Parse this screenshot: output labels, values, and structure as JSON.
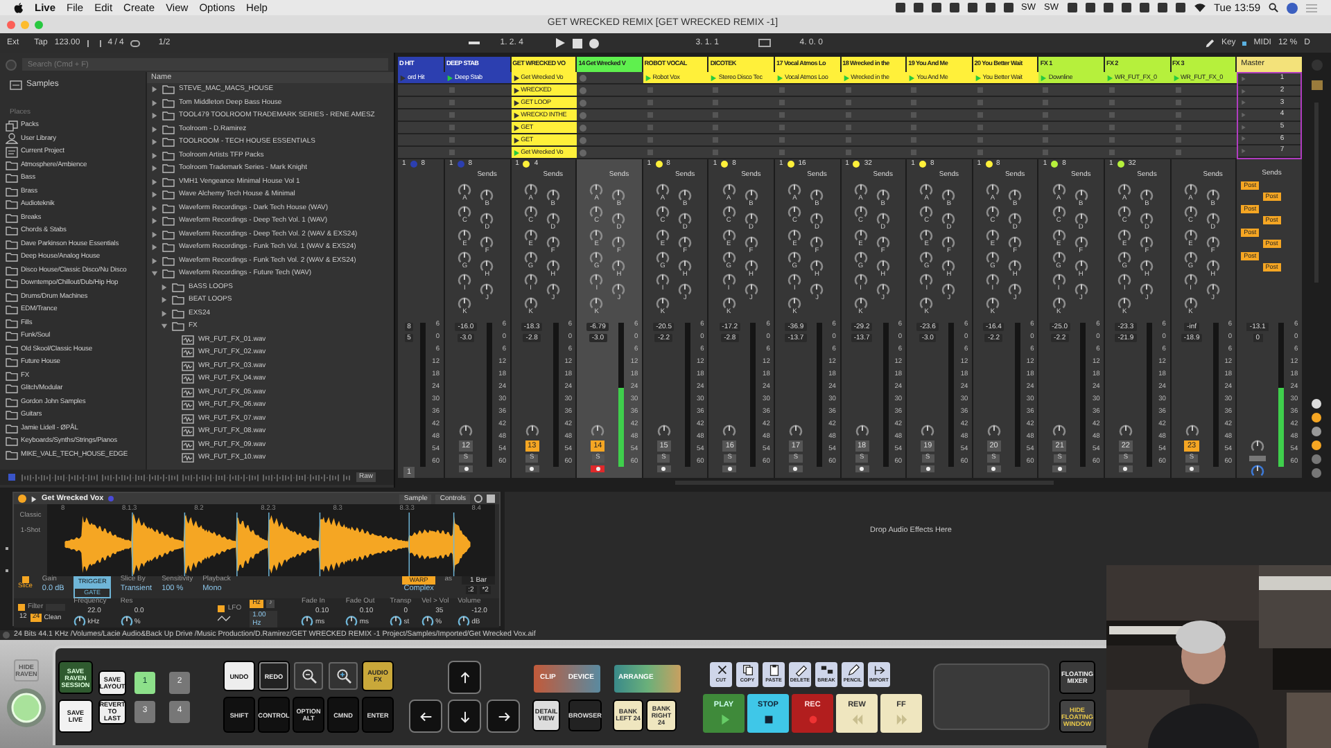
{
  "menubar": {
    "app": "Live",
    "menus": [
      "File",
      "Edit",
      "Create",
      "View",
      "Options",
      "Help"
    ],
    "extras": [
      "SW",
      "SW"
    ],
    "clock": "Tue 13:59"
  },
  "window": {
    "title": "GET WRECKED REMIX  [GET WRECKED REMIX -1]"
  },
  "transport": {
    "sync": "Ext",
    "tap": "Tap",
    "tempo": "123.00",
    "signature": "4 / 4",
    "quantize": "1/2",
    "position": "1.  2.  4",
    "loop_start": "3.  1.  1",
    "loop_length": "4.  0.  0",
    "key": "Key",
    "midi": "MIDI",
    "cpu": "12 %",
    "disk": "D"
  },
  "browser": {
    "search": {
      "placeholder": "Search (Cmd + F)"
    },
    "samples": "Samples",
    "places_label": "Places",
    "places": [
      {
        "label": "Packs",
        "kind": "pack"
      },
      {
        "label": "User Library",
        "kind": "user"
      },
      {
        "label": "Current Project",
        "kind": "project"
      },
      {
        "label": "Atmosphere/Ambience",
        "kind": "folder"
      },
      {
        "label": "Bass",
        "kind": "folder"
      },
      {
        "label": "Brass",
        "kind": "folder"
      },
      {
        "label": "Audioteknik",
        "kind": "folder"
      },
      {
        "label": "Breaks",
        "kind": "folder"
      },
      {
        "label": "Chords & Stabs",
        "kind": "folder"
      },
      {
        "label": "Dave Parkinson House Essentials",
        "kind": "folder"
      },
      {
        "label": "Deep House/Analog House",
        "kind": "folder"
      },
      {
        "label": "Disco House/Classic Disco/Nu Disco",
        "kind": "folder"
      },
      {
        "label": "Downtempo/Chillout/Dub/Hip Hop",
        "kind": "folder"
      },
      {
        "label": "Drums/Drum Machines",
        "kind": "folder"
      },
      {
        "label": "EDM/Trance",
        "kind": "folder"
      },
      {
        "label": "Fills",
        "kind": "folder"
      },
      {
        "label": "Funk/Soul",
        "kind": "folder"
      },
      {
        "label": "Old Skool/Classic House",
        "kind": "folder"
      },
      {
        "label": "Future House",
        "kind": "folder"
      },
      {
        "label": "FX",
        "kind": "folder"
      },
      {
        "label": "Glitch/Modular",
        "kind": "folder"
      },
      {
        "label": "Gordon John Samples",
        "kind": "folder"
      },
      {
        "label": "Guitars",
        "kind": "folder"
      },
      {
        "label": "Jamie Lidell - ØPÅL",
        "kind": "folder"
      },
      {
        "label": "Keyboards/Synths/Strings/Pianos",
        "kind": "folder"
      },
      {
        "label": "MIKE_VALE_TECH_HOUSE_EDGE",
        "kind": "folder"
      }
    ],
    "column": "Name",
    "items": [
      {
        "label": "STEVE_MAC_MACS_HOUSE",
        "kind": "folder",
        "expanded": false
      },
      {
        "label": "Tom Middleton Deep Bass House",
        "kind": "folder",
        "expanded": false
      },
      {
        "label": "TOOL479 TOOLROOM TRADEMARK SERIES - RENE AMESZ",
        "kind": "folder",
        "expanded": false
      },
      {
        "label": "Toolroom - D.Ramirez",
        "kind": "folder",
        "expanded": false
      },
      {
        "label": "TOOLROOM - TECH HOUSE ESSENTIALS",
        "kind": "folder",
        "expanded": false
      },
      {
        "label": "Toolroom Artists TFP Packs",
        "kind": "folder",
        "expanded": false
      },
      {
        "label": "Toolroom Trademark Series - Mark Knight",
        "kind": "folder",
        "expanded": false
      },
      {
        "label": "VMH1 Vengeance Minimal House Vol 1",
        "kind": "folder",
        "expanded": false
      },
      {
        "label": "Wave Alchemy Tech House & Minimal",
        "kind": "folder",
        "expanded": false
      },
      {
        "label": "Waveform Recordings - Dark Tech House (WAV)",
        "kind": "folder",
        "expanded": false
      },
      {
        "label": "Waveform Recordings - Deep Tech Vol. 1 (WAV)",
        "kind": "folder",
        "expanded": false
      },
      {
        "label": "Waveform Recordings - Deep Tech Vol. 2 (WAV & EXS24)",
        "kind": "folder",
        "expanded": false
      },
      {
        "label": "Waveform Recordings - Funk Tech Vol. 1 (WAV & EXS24)",
        "kind": "folder",
        "expanded": false
      },
      {
        "label": "Waveform Recordings - Funk Tech Vol. 2 (WAV & EXS24)",
        "kind": "folder",
        "expanded": false
      },
      {
        "label": "Waveform Recordings - Future Tech (WAV)",
        "kind": "folder",
        "expanded": true,
        "children": [
          {
            "label": "BASS LOOPS",
            "kind": "folder",
            "expanded": false
          },
          {
            "label": "BEAT LOOPS",
            "kind": "folder",
            "expanded": false
          },
          {
            "label": "EXS24",
            "kind": "folder",
            "expanded": false
          },
          {
            "label": "FX",
            "kind": "folder",
            "expanded": true,
            "children": [
              {
                "label": "WR_FUT_FX_01.wav",
                "kind": "file"
              },
              {
                "label": "WR_FUT_FX_02.wav",
                "kind": "file"
              },
              {
                "label": "WR_FUT_FX_03.wav",
                "kind": "file"
              },
              {
                "label": "WR_FUT_FX_04.wav",
                "kind": "file"
              },
              {
                "label": "WR_FUT_FX_05.wav",
                "kind": "file"
              },
              {
                "label": "WR_FUT_FX_06.wav",
                "kind": "file"
              },
              {
                "label": "WR_FUT_FX_07.wav",
                "kind": "file"
              },
              {
                "label": "WR_FUT_FX_08.wav",
                "kind": "file"
              },
              {
                "label": "WR_FUT_FX_09.wav",
                "kind": "file"
              },
              {
                "label": "WR_FUT_FX_10.wav",
                "kind": "file"
              }
            ]
          }
        ]
      }
    ],
    "preview": "Raw"
  },
  "tracks": [
    {
      "name": "D HIT",
      "color": "#2c3fb0",
      "clips": [
        {
          "kind": "clip",
          "name": "ord Hit",
          "playing": false
        },
        {
          "kind": "blank"
        },
        {
          "kind": "blank"
        },
        {
          "kind": "blank"
        },
        {
          "kind": "blank"
        },
        {
          "kind": "blank"
        },
        {
          "kind": "blank"
        }
      ],
      "mixer": {
        "quant": [
          "1",
          "8"
        ],
        "volume": "8",
        "pan": "5",
        "scale": [
          "6",
          "0",
          "6",
          "12",
          "18",
          "24",
          "30",
          "36",
          "42",
          "48",
          "54",
          "60"
        ],
        "number": "1",
        "active": false,
        "selected": false
      }
    },
    {
      "name": "DEEP STAB",
      "color": "#2c3fb0",
      "clips": [
        {
          "kind": "clip",
          "name": "Deep Stab",
          "playing": true
        },
        {
          "kind": "stop"
        },
        {
          "kind": "stop"
        },
        {
          "kind": "stop"
        },
        {
          "kind": "stop"
        },
        {
          "kind": "stop"
        },
        {
          "kind": "stop"
        }
      ],
      "mixer": {
        "quant": [
          "1",
          "8"
        ],
        "sends_label": "Sends",
        "sends": [
          "A",
          "B",
          "C",
          "D",
          "E",
          "F",
          "G",
          "H",
          "I",
          "J",
          "K"
        ],
        "volume": "-16.0",
        "pan": "-3.0",
        "scale": [
          "6",
          "0",
          "6",
          "12",
          "18",
          "24",
          "30",
          "36",
          "42",
          "48",
          "54",
          "60"
        ],
        "number": "12",
        "solo": "S",
        "active": false,
        "selected": false,
        "armed": false
      }
    },
    {
      "name": "GET WRECKED VO",
      "color": "#fff03a",
      "clips": [
        {
          "kind": "clip",
          "name": "Get Wrecked Vo",
          "playing": false
        },
        {
          "kind": "clip",
          "name": "WRECKED",
          "playing": false
        },
        {
          "kind": "clip",
          "name": "GET LOOP",
          "playing": false
        },
        {
          "kind": "clip",
          "name": "WRECKD INTHE",
          "playing": false
        },
        {
          "kind": "clip",
          "name": "GET",
          "playing": false
        },
        {
          "kind": "clip",
          "name": "GET",
          "playing": false
        },
        {
          "kind": "clip",
          "name": "Get Wrecked Vo",
          "playing": true
        }
      ],
      "mixer": {
        "quant": [
          "1",
          "4"
        ],
        "sends_label": "Sends",
        "sends": [
          "A",
          "B",
          "C",
          "D",
          "E",
          "F",
          "G",
          "H",
          "I",
          "J",
          "K"
        ],
        "volume": "-18.3",
        "pan": "-2.8",
        "scale": [
          "6",
          "0",
          "6",
          "12",
          "18",
          "24",
          "30",
          "36",
          "42",
          "48",
          "54",
          "60"
        ],
        "number": "13",
        "solo": "S",
        "active": true,
        "selected": false,
        "armed": false
      }
    },
    {
      "name": "14 Get Wrecked V",
      "color": "#5ff04e",
      "clips": [
        {
          "kind": "rec"
        },
        {
          "kind": "rec"
        },
        {
          "kind": "rec"
        },
        {
          "kind": "rec"
        },
        {
          "kind": "rec"
        },
        {
          "kind": "rec"
        },
        {
          "kind": "rec"
        }
      ],
      "mixer": {
        "sends_label": "Sends",
        "sends": [
          "A",
          "B",
          "C",
          "D",
          "E",
          "F",
          "G",
          "H",
          "I",
          "J",
          "K"
        ],
        "volume": "-6.79",
        "pan": "-3.0",
        "scale": [
          "6",
          "0",
          "6",
          "12",
          "18",
          "24",
          "30",
          "36",
          "42",
          "48",
          "54",
          "60"
        ],
        "number": "14",
        "solo": "S",
        "active": true,
        "selected": true,
        "armed": true,
        "level": 0.55
      }
    },
    {
      "name": "ROBOT VOCAL",
      "color": "#fff03a",
      "clips": [
        {
          "kind": "clip",
          "name": "Robot Vox",
          "playing": true
        },
        {
          "kind": "stop"
        },
        {
          "kind": "stop"
        },
        {
          "kind": "stop"
        },
        {
          "kind": "stop"
        },
        {
          "kind": "stop"
        },
        {
          "kind": "stop"
        }
      ],
      "mixer": {
        "quant": [
          "1",
          "8"
        ],
        "sends_label": "Sends",
        "sends": [
          "A",
          "B",
          "C",
          "D",
          "E",
          "F",
          "G",
          "H",
          "I",
          "J",
          "K"
        ],
        "volume": "-20.5",
        "pan": "-2.2",
        "scale": [
          "6",
          "0",
          "6",
          "12",
          "18",
          "24",
          "30",
          "36",
          "42",
          "48",
          "54",
          "60"
        ],
        "number": "15",
        "solo": "S",
        "active": false,
        "selected": false,
        "armed": false
      }
    },
    {
      "name": "DICOTEK",
      "color": "#fff03a",
      "clips": [
        {
          "kind": "clip",
          "name": "Stereo Disco Tec",
          "playing": true
        },
        {
          "kind": "stop"
        },
        {
          "kind": "stop"
        },
        {
          "kind": "stop"
        },
        {
          "kind": "stop"
        },
        {
          "kind": "stop"
        },
        {
          "kind": "stop"
        }
      ],
      "mixer": {
        "quant": [
          "1",
          "8"
        ],
        "sends_label": "Sends",
        "sends": [
          "A",
          "B",
          "C",
          "D",
          "E",
          "F",
          "G",
          "H",
          "I",
          "J",
          "K"
        ],
        "volume": "-17.2",
        "pan": "-2.8",
        "scale": [
          "6",
          "0",
          "6",
          "12",
          "18",
          "24",
          "30",
          "36",
          "42",
          "48",
          "54",
          "60"
        ],
        "number": "16",
        "solo": "S",
        "active": false,
        "selected": false,
        "armed": false
      }
    },
    {
      "name": "17 Vocal Atmos Lo",
      "color": "#fff03a",
      "clips": [
        {
          "kind": "clip",
          "name": "Vocal Atmos Loo",
          "playing": true
        },
        {
          "kind": "stop"
        },
        {
          "kind": "stop"
        },
        {
          "kind": "stop"
        },
        {
          "kind": "stop"
        },
        {
          "kind": "stop"
        },
        {
          "kind": "stop"
        }
      ],
      "mixer": {
        "quant": [
          "1",
          "16"
        ],
        "sends_label": "Sends",
        "sends": [
          "A",
          "B",
          "C",
          "D",
          "E",
          "F",
          "G",
          "H",
          "I",
          "J",
          "K"
        ],
        "volume": "-36.9",
        "pan": "-13.7",
        "scale": [
          "6",
          "0",
          "6",
          "12",
          "18",
          "24",
          "30",
          "36",
          "42",
          "48",
          "54",
          "60"
        ],
        "number": "17",
        "solo": "S",
        "active": false,
        "selected": false,
        "armed": false
      }
    },
    {
      "name": "18 Wrecked in the",
      "color": "#fff03a",
      "clips": [
        {
          "kind": "clip",
          "name": "Wrecked in the",
          "playing": true
        },
        {
          "kind": "stop"
        },
        {
          "kind": "stop"
        },
        {
          "kind": "stop"
        },
        {
          "kind": "stop"
        },
        {
          "kind": "stop"
        },
        {
          "kind": "stop"
        }
      ],
      "mixer": {
        "quant": [
          "1",
          "32"
        ],
        "sends_label": "Sends",
        "sends": [
          "A",
          "B",
          "C",
          "D",
          "E",
          "F",
          "G",
          "H",
          "I",
          "J",
          "K"
        ],
        "volume": "-29.2",
        "pan": "-13.7",
        "scale": [
          "6",
          "0",
          "6",
          "12",
          "18",
          "24",
          "30",
          "36",
          "42",
          "48",
          "54",
          "60"
        ],
        "number": "18",
        "solo": "S",
        "active": false,
        "selected": false,
        "armed": false
      }
    },
    {
      "name": "19 You And Me",
      "color": "#fff03a",
      "clips": [
        {
          "kind": "clip",
          "name": "You And Me",
          "playing": true
        },
        {
          "kind": "stop"
        },
        {
          "kind": "stop"
        },
        {
          "kind": "stop"
        },
        {
          "kind": "stop"
        },
        {
          "kind": "stop"
        },
        {
          "kind": "stop"
        }
      ],
      "mixer": {
        "quant": [
          "1",
          "8"
        ],
        "sends_label": "Sends",
        "sends": [
          "A",
          "B",
          "C",
          "D",
          "E",
          "F",
          "G",
          "H",
          "I",
          "J",
          "K"
        ],
        "volume": "-23.6",
        "pan": "-3.0",
        "scale": [
          "6",
          "0",
          "6",
          "12",
          "18",
          "24",
          "30",
          "36",
          "42",
          "48",
          "54",
          "60"
        ],
        "number": "19",
        "solo": "S",
        "active": false,
        "selected": false,
        "armed": false
      }
    },
    {
      "name": "20 You Better Wait",
      "color": "#fff03a",
      "clips": [
        {
          "kind": "clip",
          "name": "You Better Wait",
          "playing": true
        },
        {
          "kind": "stop"
        },
        {
          "kind": "stop"
        },
        {
          "kind": "stop"
        },
        {
          "kind": "stop"
        },
        {
          "kind": "stop"
        },
        {
          "kind": "stop"
        }
      ],
      "mixer": {
        "quant": [
          "1",
          "8"
        ],
        "sends_label": "Sends",
        "sends": [
          "A",
          "B",
          "C",
          "D",
          "E",
          "F",
          "G",
          "H",
          "I",
          "J",
          "K"
        ],
        "volume": "-16.4",
        "pan": "-2.2",
        "scale": [
          "6",
          "0",
          "6",
          "12",
          "18",
          "24",
          "30",
          "36",
          "42",
          "48",
          "54",
          "60"
        ],
        "number": "20",
        "solo": "S",
        "active": false,
        "selected": false,
        "armed": false
      }
    },
    {
      "name": "FX 1",
      "color": "#b6f03c",
      "clips": [
        {
          "kind": "clip",
          "name": "Downline",
          "playing": true
        },
        {
          "kind": "stop"
        },
        {
          "kind": "stop"
        },
        {
          "kind": "stop"
        },
        {
          "kind": "stop"
        },
        {
          "kind": "stop"
        },
        {
          "kind": "stop"
        }
      ],
      "mixer": {
        "quant": [
          "1",
          "8"
        ],
        "sends_label": "Sends",
        "sends": [
          "A",
          "B",
          "C",
          "D",
          "E",
          "F",
          "G",
          "H",
          "I",
          "J",
          "K"
        ],
        "volume": "-25.0",
        "pan": "-2.2",
        "scale": [
          "6",
          "0",
          "6",
          "12",
          "18",
          "24",
          "30",
          "36",
          "42",
          "48",
          "54",
          "60"
        ],
        "number": "21",
        "solo": "S",
        "active": false,
        "selected": false,
        "armed": false
      }
    },
    {
      "name": "FX 2",
      "color": "#b6f03c",
      "clips": [
        {
          "kind": "clip",
          "name": "WR_FUT_FX_0",
          "playing": true
        },
        {
          "kind": "stop"
        },
        {
          "kind": "stop"
        },
        {
          "kind": "stop"
        },
        {
          "kind": "stop"
        },
        {
          "kind": "stop"
        },
        {
          "kind": "stop"
        }
      ],
      "mixer": {
        "quant": [
          "1",
          "32"
        ],
        "sends_label": "Sends",
        "sends": [
          "A",
          "B",
          "C",
          "D",
          "E",
          "F",
          "G",
          "H",
          "I",
          "J",
          "K"
        ],
        "volume": "-23.3",
        "pan": "-21.9",
        "scale": [
          "6",
          "0",
          "6",
          "12",
          "18",
          "24",
          "30",
          "36",
          "42",
          "48",
          "54",
          "60"
        ],
        "number": "22",
        "solo": "S",
        "active": false,
        "selected": false,
        "armed": false
      }
    },
    {
      "name": "FX 3",
      "color": "#b6f03c",
      "clips": [
        {
          "kind": "clip",
          "name": "WR_FUT_FX_0",
          "playing": true
        },
        {
          "kind": "stop"
        },
        {
          "kind": "stop"
        },
        {
          "kind": "stop"
        },
        {
          "kind": "stop"
        },
        {
          "kind": "stop"
        },
        {
          "kind": "stop"
        }
      ],
      "mixer": {
        "sends_label": "Sends",
        "sends": [
          "A",
          "B",
          "C",
          "D",
          "E",
          "F",
          "G",
          "H",
          "I",
          "J",
          "K"
        ],
        "volume": "-inf",
        "pan": "-18.9",
        "scale": [
          "6",
          "0",
          "6",
          "12",
          "18",
          "24",
          "30",
          "36",
          "42",
          "48",
          "54",
          "60"
        ],
        "number": "23",
        "solo": "S",
        "active": true,
        "selected": false,
        "armed": false
      }
    }
  ],
  "master": {
    "name": "Master",
    "scenes": [
      "1",
      "2",
      "3",
      "4",
      "5",
      "6",
      "7"
    ],
    "sends_label": "Sends",
    "posts": [
      "Post",
      "Post",
      "Post",
      "Post",
      "Post",
      "Post",
      "Post",
      "Post"
    ],
    "volume": "-13.1",
    "pan": "0",
    "scale": [
      "6",
      "0",
      "6",
      "12",
      "18",
      "24",
      "30",
      "36",
      "42",
      "48",
      "54",
      "60"
    ],
    "level": 0.55
  },
  "device": {
    "title": "Get Wrecked Vox",
    "tabs": [
      "Sample",
      "Controls"
    ],
    "modes": [
      {
        "label": "Classic",
        "selected": false
      },
      {
        "label": "1-Shot",
        "selected": false
      },
      {
        "label": "Slice",
        "selected": true
      }
    ],
    "ruler": [
      "8",
      "8.1.3",
      "8.2",
      "8.2.3",
      "8.3",
      "8.3.3",
      "8.4"
    ],
    "gain": {
      "label": "Gain",
      "value": "0.0 dB"
    },
    "trigger": [
      {
        "label": "TRIGGER",
        "selected": true
      },
      {
        "label": "GATE",
        "selected": false
      }
    ],
    "slice_by": {
      "label": "Slice By",
      "value": "Transient"
    },
    "sensitivity": {
      "label": "Sensitivity",
      "value": "100 %"
    },
    "playback": {
      "label": "Playback",
      "value": "Mono"
    },
    "warp": {
      "label": "WARP",
      "on": true
    },
    "as": "as",
    "bars": "1 Bar",
    "half": ":2",
    "double": "*2",
    "warp_mode": "Complex",
    "filter": {
      "label": "Filter",
      "on": true
    },
    "slopes": [
      {
        "label": "12",
        "selected": false
      },
      {
        "label": "24",
        "selected": true
      }
    ],
    "circuit": "Clean",
    "knobs": [
      {
        "label": "Frequency",
        "value": "22.0 kHz"
      },
      {
        "label": "Res",
        "value": "0.0 %"
      }
    ],
    "lfo": {
      "label": "LFO",
      "on": true
    },
    "lfo_modes": [
      {
        "label": "Hz",
        "selected": true
      },
      {
        "label": "♪",
        "selected": false
      }
    ],
    "lfo_rate": "1.00 Hz",
    "envelope": [
      {
        "label": "Fade In",
        "value": "0.10 ms"
      },
      {
        "label": "Fade Out",
        "value": "0.10 ms"
      },
      {
        "label": "Transp",
        "value": "0 st"
      },
      {
        "label": "Vel > Vol",
        "value": "35 %"
      },
      {
        "label": "Volume",
        "value": "-12.0 dB"
      }
    ]
  },
  "effects_drop": "Drop Audio Effects Here",
  "status_bar": "24 Bits 44.1 KHz /Volumes/Lacie Audio&Back Up Drive /Music Production/D.Ramirez/GET WRECKED REMIX -1 Project/Samples/Imported/Get Wrecked Vox.aif",
  "raven": {
    "hide": "HIDE RAVEN",
    "save_session": "SAVE RAVEN SESSION",
    "save_live": "SAVE LIVE",
    "layouts": [
      {
        "label": "SAVE LAYOUT",
        "kind": "action"
      },
      {
        "label": "1",
        "kind": "slot",
        "selected": true
      },
      {
        "label": "2",
        "kind": "slot",
        "selected": false
      },
      {
        "label": "REVERT TO LAST",
        "kind": "action"
      },
      {
        "label": "3",
        "kind": "slot",
        "selected": false
      },
      {
        "label": "4",
        "kind": "slot",
        "selected": false
      }
    ],
    "edit": [
      {
        "label": "UNDO",
        "kind": "light"
      },
      {
        "label": "REDO",
        "kind": "dark"
      },
      {
        "kind": "zoom-out"
      },
      {
        "kind": "zoom-in"
      },
      {
        "label": "AUDIO FX",
        "kind": "gold"
      }
    ],
    "modifiers": [
      "SHIFT",
      "CONTROL",
      "OPTION ALT",
      "CMND",
      "ENTER"
    ],
    "arrows": [
      {
        "kind": "up"
      },
      {
        "kind": "left"
      },
      {
        "kind": "down"
      },
      {
        "kind": "right"
      }
    ],
    "clip_device": [
      "CLIP",
      "DEVICE"
    ],
    "arrange": "ARRANGE",
    "views": [
      "DETAIL VIEW",
      "BROWSER"
    ],
    "banks": [
      "BANK LEFT 24",
      "BANK RIGHT 24"
    ],
    "tools": [
      "CUT",
      "COPY",
      "PASTE",
      "DELETE",
      "BREAK",
      "PENCIL",
      "IMPORT"
    ],
    "transport": [
      {
        "label": "PLAY",
        "kind": "play"
      },
      {
        "label": "STOP",
        "kind": "stop"
      },
      {
        "label": "REC",
        "kind": "rec"
      },
      {
        "label": "REW",
        "kind": "rew"
      },
      {
        "label": "FF",
        "kind": "ff"
      }
    ],
    "floating": [
      "FLOATING MIXER",
      "HIDE FLOATING WINDOW"
    ]
  }
}
